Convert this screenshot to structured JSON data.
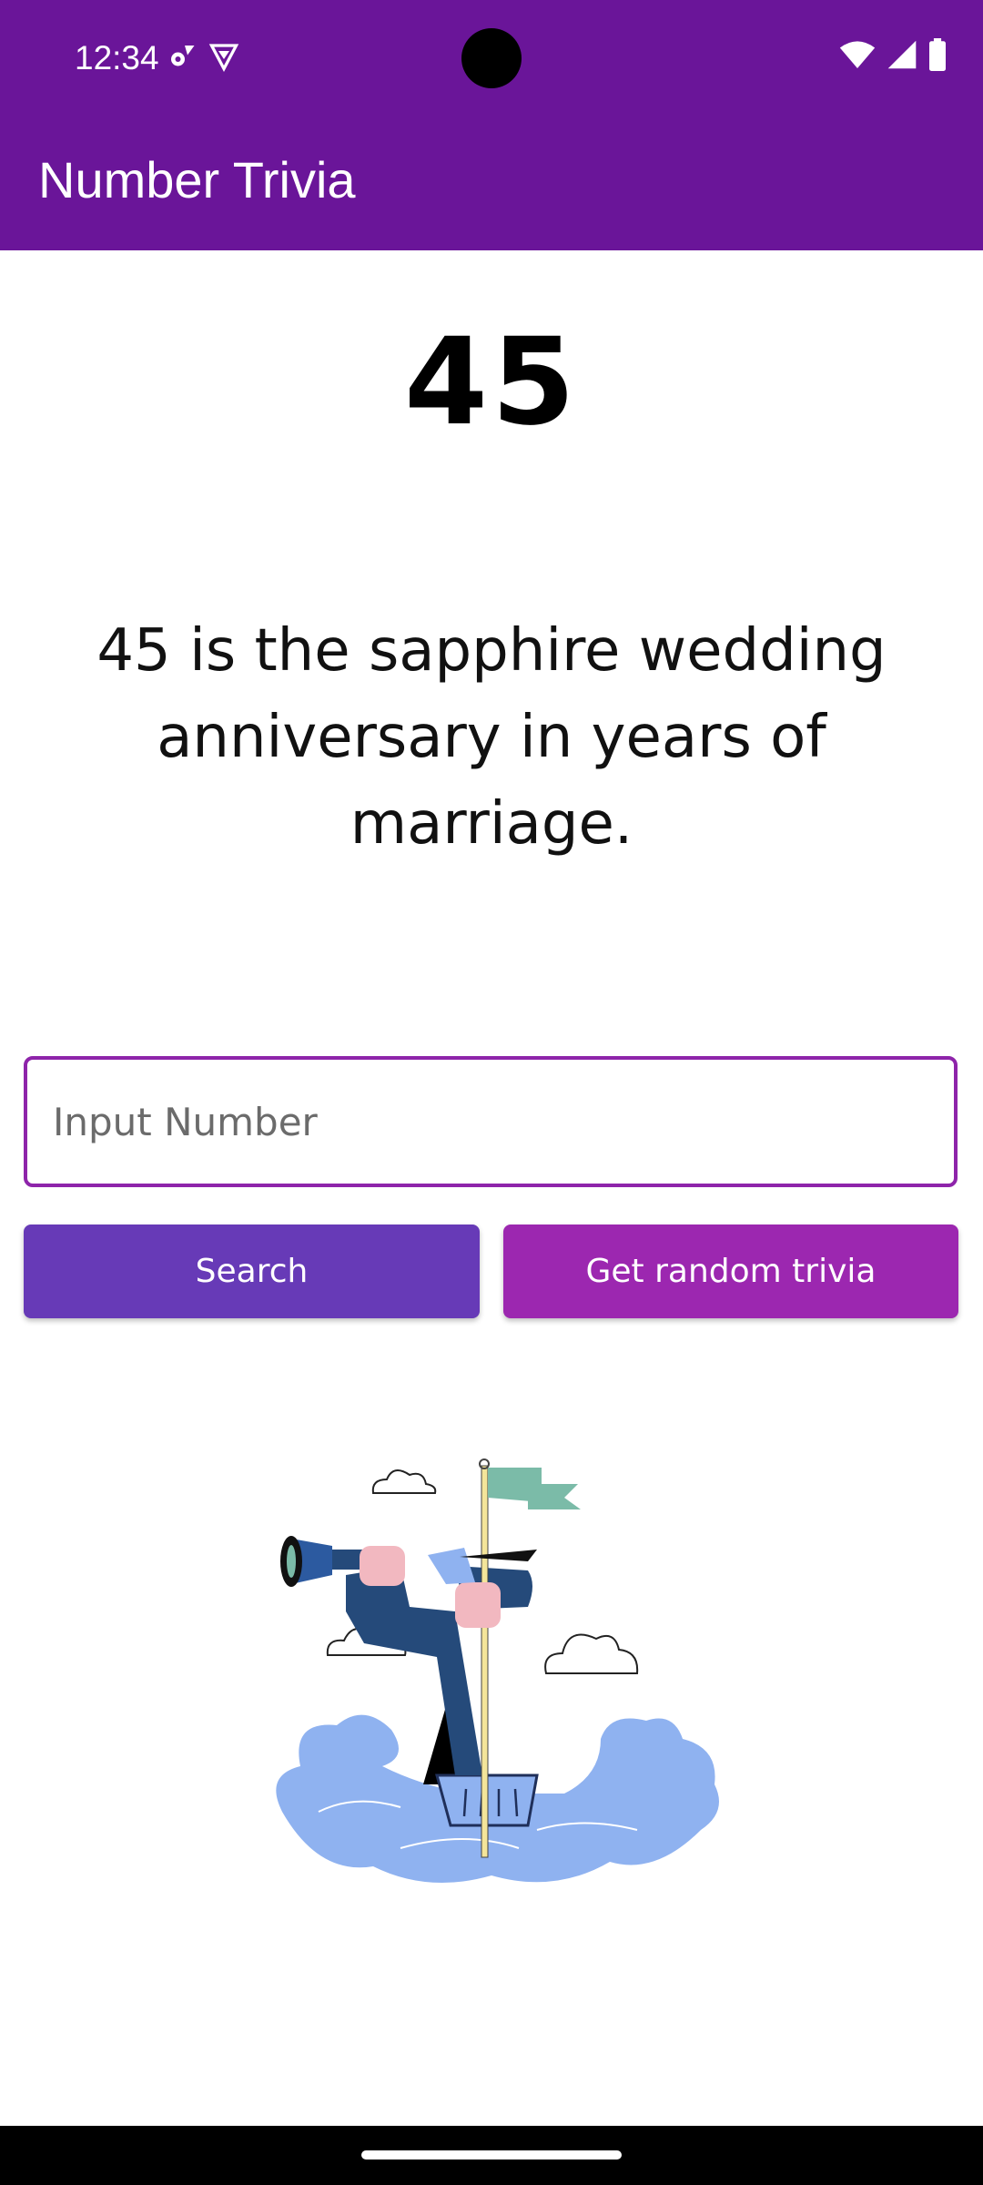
{
  "status_bar": {
    "time": "12:34",
    "left_icons": [
      "gear-icon",
      "shield-icon"
    ],
    "right_icons": [
      "wifi-icon",
      "cell-signal-icon",
      "battery-icon"
    ]
  },
  "app_bar": {
    "title": "Number Trivia",
    "color": "#6a1599"
  },
  "trivia": {
    "number": "45",
    "text": "45 is the sapphire wedding anniversary in years of marriage."
  },
  "input": {
    "value": "",
    "placeholder": "Input Number",
    "border_color": "#8e24aa"
  },
  "buttons": {
    "search_label": "Search",
    "search_color": "#673ab7",
    "random_label": "Get random trivia",
    "random_color": "#9c27b0"
  },
  "illustration": {
    "icon": "sailor-with-telescope-illustration"
  }
}
